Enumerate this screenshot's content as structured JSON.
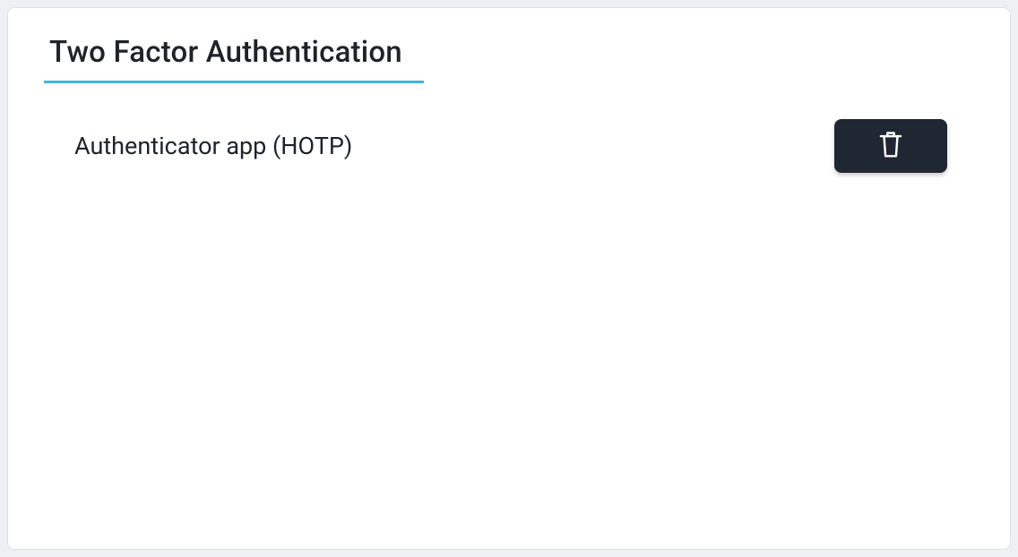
{
  "header": {
    "title": "Two Factor Authentication"
  },
  "methods": [
    {
      "label": "Authenticator app (HOTP)"
    }
  ]
}
